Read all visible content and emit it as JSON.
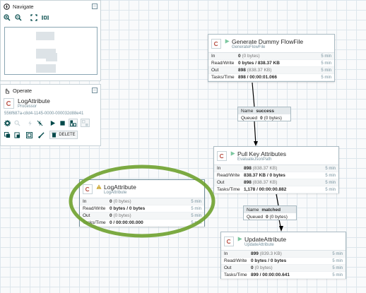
{
  "navigate": {
    "title": "Navigate",
    "tools": [
      "zoom-in-icon",
      "zoom-out-icon",
      "fit-icon",
      "actual-size-icon"
    ]
  },
  "operate": {
    "title": "Operate",
    "name": "LogAttribute",
    "type": "Processor",
    "id": "556f687a-c8d4-1145-0000-000032d88e41",
    "delete_label": "DELETE"
  },
  "processors": [
    {
      "name": "Generate Dummy FlowFile",
      "type": "GenerateFlowFile",
      "state": "running",
      "stats": [
        {
          "label": "In",
          "value": "0",
          "detail": "(0 bytes)",
          "period": "5 min"
        },
        {
          "label": "Read/Write",
          "value": "0 bytes / 838.37 KB",
          "detail": "",
          "period": "5 min"
        },
        {
          "label": "Out",
          "value": "898",
          "detail": "(838.37 KB)",
          "period": "5 min"
        },
        {
          "label": "Tasks/Time",
          "value": "898 / 00:00:01.066",
          "detail": "",
          "period": "5 min"
        }
      ]
    },
    {
      "name": "Pull Key Attributes",
      "type": "EvaluateJsonPath",
      "state": "running",
      "stats": [
        {
          "label": "In",
          "value": "898",
          "detail": "(838.37 KB)",
          "period": "5 min"
        },
        {
          "label": "Read/Write",
          "value": "838.37 KB / 0 bytes",
          "detail": "",
          "period": "5 min"
        },
        {
          "label": "Out",
          "value": "898",
          "detail": "(838.37 KB)",
          "period": "5 min"
        },
        {
          "label": "Tasks/Time",
          "value": "1,178 / 00:00:00.882",
          "detail": "",
          "period": "5 min"
        }
      ]
    },
    {
      "name": "LogAttribute",
      "type": "LogAttribute",
      "state": "invalid",
      "stats": [
        {
          "label": "In",
          "value": "0",
          "detail": "(0 bytes)",
          "period": "5 min"
        },
        {
          "label": "Read/Write",
          "value": "0 bytes / 0 bytes",
          "detail": "",
          "period": "5 min"
        },
        {
          "label": "Out",
          "value": "0",
          "detail": "(0 bytes)",
          "period": "5 min"
        },
        {
          "label": "Tasks/Time",
          "value": "0 / 00:00:00.000",
          "detail": "",
          "period": "5 min"
        }
      ]
    },
    {
      "name": "UpdateAttribute",
      "type": "UpdateAttribute",
      "state": "running",
      "stats": [
        {
          "label": "In",
          "value": "899",
          "detail": "(839.3 KB)",
          "period": "5 min"
        },
        {
          "label": "Read/Write",
          "value": "0 bytes / 0 bytes",
          "detail": "",
          "period": "5 min"
        },
        {
          "label": "Out",
          "value": "0",
          "detail": "(0 bytes)",
          "period": "5 min"
        },
        {
          "label": "Tasks/Time",
          "value": "899 / 00:00:00.641",
          "detail": "",
          "period": "5 min"
        }
      ]
    }
  ],
  "connections": [
    {
      "name_label": "Name",
      "name": "success",
      "queued_label": "Queued",
      "queued": "0",
      "queued_detail": "(0 bytes)"
    },
    {
      "name_label": "Name",
      "name": "matched",
      "queued_label": "Queued",
      "queued": "0",
      "queued_detail": "(0 bytes)"
    }
  ],
  "colors": {
    "running": "#7dc7a0",
    "warning": "#ba554a",
    "highlight": "#6ea12e",
    "border": "#aabbc3"
  }
}
